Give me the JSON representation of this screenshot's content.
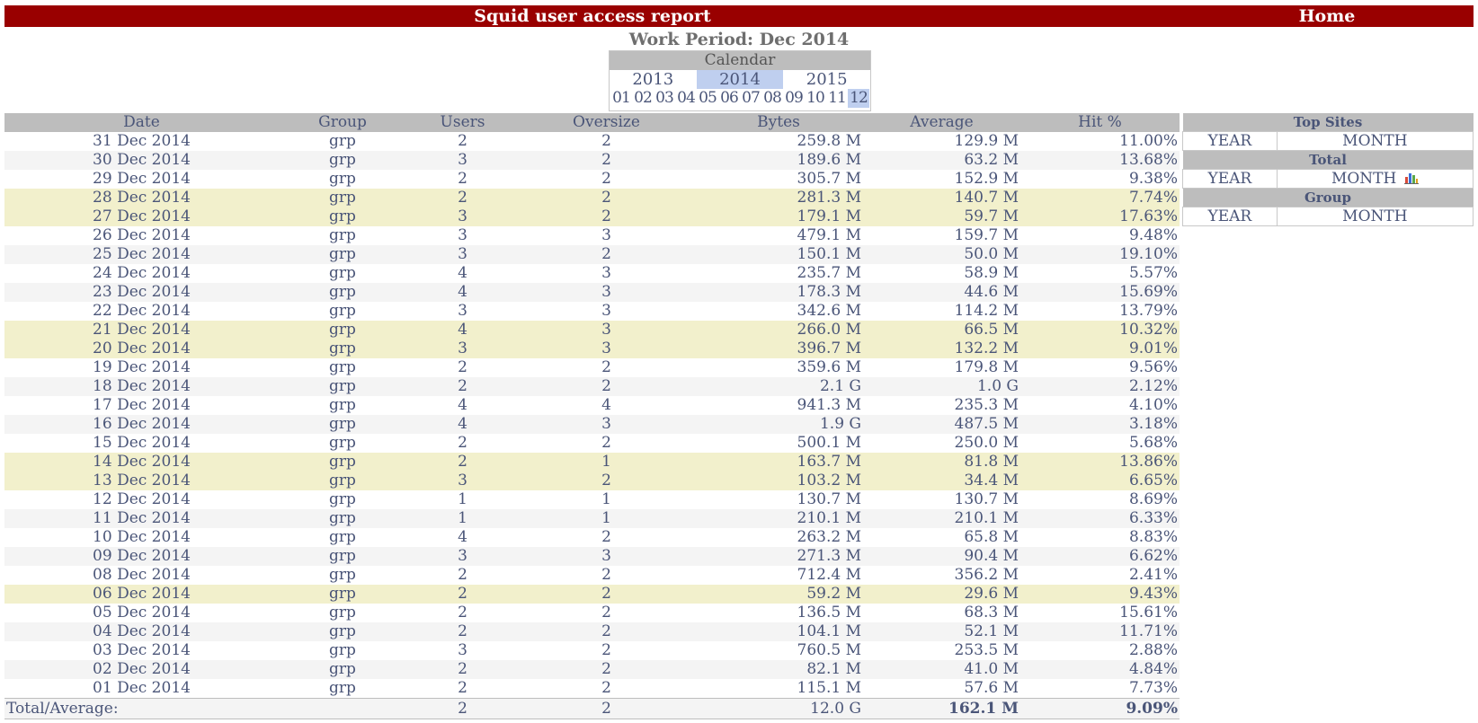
{
  "header": {
    "title": "Squid user access report",
    "home": "Home"
  },
  "period": "Work Period: Dec 2014",
  "calendar": {
    "title": "Calendar",
    "years": [
      "2013",
      "2014",
      "2015"
    ],
    "selected_year": "2014",
    "months": [
      "01",
      "02",
      "03",
      "04",
      "05",
      "06",
      "07",
      "08",
      "09",
      "10",
      "11",
      "12"
    ],
    "selected_month": "12"
  },
  "table": {
    "columns": [
      "Date",
      "Group",
      "Users",
      "Oversize",
      "Bytes",
      "Average",
      "Hit %"
    ],
    "rows": [
      {
        "date": "31 Dec 2014",
        "group": "grp",
        "users": "2",
        "oversize": "2",
        "bytes": "259.8 M",
        "average": "129.9 M",
        "hit": "11.00%",
        "style": "odd"
      },
      {
        "date": "30 Dec 2014",
        "group": "grp",
        "users": "3",
        "oversize": "2",
        "bytes": "189.6 M",
        "average": "63.2 M",
        "hit": "13.68%",
        "style": "even"
      },
      {
        "date": "29 Dec 2014",
        "group": "grp",
        "users": "2",
        "oversize": "2",
        "bytes": "305.7 M",
        "average": "152.9 M",
        "hit": "9.38%",
        "style": "odd"
      },
      {
        "date": "28 Dec 2014",
        "group": "grp",
        "users": "2",
        "oversize": "2",
        "bytes": "281.3 M",
        "average": "140.7 M",
        "hit": "7.74%",
        "style": "weekend"
      },
      {
        "date": "27 Dec 2014",
        "group": "grp",
        "users": "3",
        "oversize": "2",
        "bytes": "179.1 M",
        "average": "59.7 M",
        "hit": "17.63%",
        "style": "weekend"
      },
      {
        "date": "26 Dec 2014",
        "group": "grp",
        "users": "3",
        "oversize": "3",
        "bytes": "479.1 M",
        "average": "159.7 M",
        "hit": "9.48%",
        "style": "odd"
      },
      {
        "date": "25 Dec 2014",
        "group": "grp",
        "users": "3",
        "oversize": "2",
        "bytes": "150.1 M",
        "average": "50.0 M",
        "hit": "19.10%",
        "style": "even"
      },
      {
        "date": "24 Dec 2014",
        "group": "grp",
        "users": "4",
        "oversize": "3",
        "bytes": "235.7 M",
        "average": "58.9 M",
        "hit": "5.57%",
        "style": "odd"
      },
      {
        "date": "23 Dec 2014",
        "group": "grp",
        "users": "4",
        "oversize": "3",
        "bytes": "178.3 M",
        "average": "44.6 M",
        "hit": "15.69%",
        "style": "even"
      },
      {
        "date": "22 Dec 2014",
        "group": "grp",
        "users": "3",
        "oversize": "3",
        "bytes": "342.6 M",
        "average": "114.2 M",
        "hit": "13.79%",
        "style": "odd"
      },
      {
        "date": "21 Dec 2014",
        "group": "grp",
        "users": "4",
        "oversize": "3",
        "bytes": "266.0 M",
        "average": "66.5 M",
        "hit": "10.32%",
        "style": "weekend"
      },
      {
        "date": "20 Dec 2014",
        "group": "grp",
        "users": "3",
        "oversize": "3",
        "bytes": "396.7 M",
        "average": "132.2 M",
        "hit": "9.01%",
        "style": "weekend"
      },
      {
        "date": "19 Dec 2014",
        "group": "grp",
        "users": "2",
        "oversize": "2",
        "bytes": "359.6 M",
        "average": "179.8 M",
        "hit": "9.56%",
        "style": "odd"
      },
      {
        "date": "18 Dec 2014",
        "group": "grp",
        "users": "2",
        "oversize": "2",
        "bytes": "2.1 G",
        "average": "1.0 G",
        "hit": "2.12%",
        "style": "even"
      },
      {
        "date": "17 Dec 2014",
        "group": "grp",
        "users": "4",
        "oversize": "4",
        "bytes": "941.3 M",
        "average": "235.3 M",
        "hit": "4.10%",
        "style": "odd"
      },
      {
        "date": "16 Dec 2014",
        "group": "grp",
        "users": "4",
        "oversize": "3",
        "bytes": "1.9 G",
        "average": "487.5 M",
        "hit": "3.18%",
        "style": "even"
      },
      {
        "date": "15 Dec 2014",
        "group": "grp",
        "users": "2",
        "oversize": "2",
        "bytes": "500.1 M",
        "average": "250.0 M",
        "hit": "5.68%",
        "style": "odd"
      },
      {
        "date": "14 Dec 2014",
        "group": "grp",
        "users": "2",
        "oversize": "1",
        "bytes": "163.7 M",
        "average": "81.8 M",
        "hit": "13.86%",
        "style": "weekend"
      },
      {
        "date": "13 Dec 2014",
        "group": "grp",
        "users": "3",
        "oversize": "2",
        "bytes": "103.2 M",
        "average": "34.4 M",
        "hit": "6.65%",
        "style": "weekend"
      },
      {
        "date": "12 Dec 2014",
        "group": "grp",
        "users": "1",
        "oversize": "1",
        "bytes": "130.7 M",
        "average": "130.7 M",
        "hit": "8.69%",
        "style": "odd"
      },
      {
        "date": "11 Dec 2014",
        "group": "grp",
        "users": "1",
        "oversize": "1",
        "bytes": "210.1 M",
        "average": "210.1 M",
        "hit": "6.33%",
        "style": "even"
      },
      {
        "date": "10 Dec 2014",
        "group": "grp",
        "users": "4",
        "oversize": "2",
        "bytes": "263.2 M",
        "average": "65.8 M",
        "hit": "8.83%",
        "style": "odd"
      },
      {
        "date": "09 Dec 2014",
        "group": "grp",
        "users": "3",
        "oversize": "3",
        "bytes": "271.3 M",
        "average": "90.4 M",
        "hit": "6.62%",
        "style": "even"
      },
      {
        "date": "08 Dec 2014",
        "group": "grp",
        "users": "2",
        "oversize": "2",
        "bytes": "712.4 M",
        "average": "356.2 M",
        "hit": "2.41%",
        "style": "odd"
      },
      {
        "date": "06 Dec 2014",
        "group": "grp",
        "users": "2",
        "oversize": "2",
        "bytes": "59.2 M",
        "average": "29.6 M",
        "hit": "9.43%",
        "style": "weekend"
      },
      {
        "date": "05 Dec 2014",
        "group": "grp",
        "users": "2",
        "oversize": "2",
        "bytes": "136.5 M",
        "average": "68.3 M",
        "hit": "15.61%",
        "style": "odd"
      },
      {
        "date": "04 Dec 2014",
        "group": "grp",
        "users": "2",
        "oversize": "2",
        "bytes": "104.1 M",
        "average": "52.1 M",
        "hit": "11.71%",
        "style": "even"
      },
      {
        "date": "03 Dec 2014",
        "group": "grp",
        "users": "3",
        "oversize": "2",
        "bytes": "760.5 M",
        "average": "253.5 M",
        "hit": "2.88%",
        "style": "odd"
      },
      {
        "date": "02 Dec 2014",
        "group": "grp",
        "users": "2",
        "oversize": "2",
        "bytes": "82.1 M",
        "average": "41.0 M",
        "hit": "4.84%",
        "style": "even"
      },
      {
        "date": "01 Dec 2014",
        "group": "grp",
        "users": "2",
        "oversize": "2",
        "bytes": "115.1 M",
        "average": "57.6 M",
        "hit": "7.73%",
        "style": "odd"
      }
    ],
    "total": {
      "label": "Total/Average:",
      "users": "2",
      "oversize": "2",
      "bytes": "12.0 G",
      "average": "162.1 M",
      "hit": "9.09%"
    }
  },
  "side": {
    "top_sites": {
      "title": "Top Sites",
      "year": "YEAR",
      "month": "MONTH"
    },
    "total": {
      "title": "Total",
      "year": "YEAR",
      "month": "MONTH",
      "icon": "bar-chart-icon"
    },
    "group": {
      "title": "Group",
      "year": "YEAR",
      "month": "MONTH"
    }
  },
  "colors": {
    "header_bg": "#990000",
    "table_header_bg": "#bdbdbd",
    "weekend_row_bg": "#f2f0cc",
    "selected_bg": "#bfcfef",
    "text": "#4a5578"
  }
}
